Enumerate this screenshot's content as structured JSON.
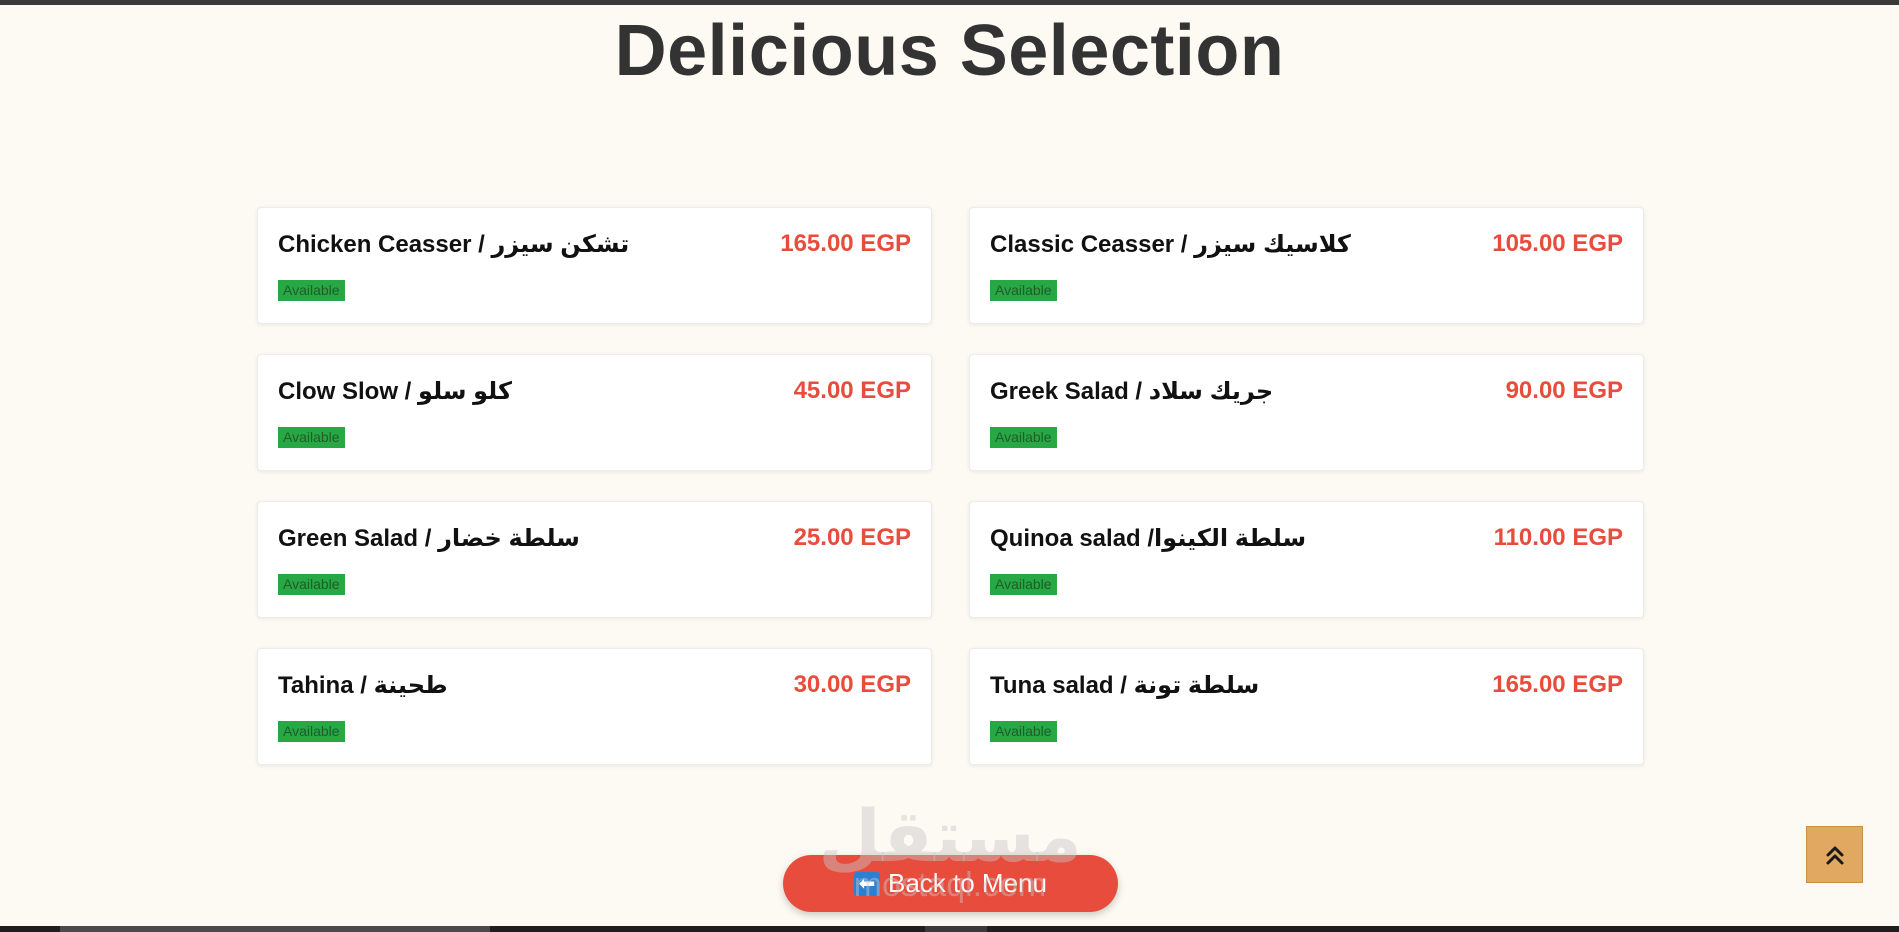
{
  "page": {
    "title": "Delicious Selection"
  },
  "items": [
    {
      "name": "Chicken Ceasser / تشكن سيزر",
      "price": "165.00 EGP",
      "status": "Available"
    },
    {
      "name": "Classic Ceasser / كلاسيك سيزر",
      "price": "105.00 EGP",
      "status": "Available"
    },
    {
      "name": "Clow Slow / كلو سلو",
      "price": "45.00 EGP",
      "status": "Available"
    },
    {
      "name": "Greek Salad / جريك سلاد",
      "price": "90.00 EGP",
      "status": "Available"
    },
    {
      "name": "Green Salad / سلطة خضار",
      "price": "25.00 EGP",
      "status": "Available"
    },
    {
      "name": "Quinoa salad /سلطة الكينوا",
      "price": "110.00 EGP",
      "status": "Available"
    },
    {
      "name": "Tahina / طحينة",
      "price": "30.00 EGP",
      "status": "Available"
    },
    {
      "name": "Tuna salad / سلطة تونة",
      "price": "165.00 EGP",
      "status": "Available"
    }
  ],
  "back_button": {
    "icon": "⬅",
    "label": "Back to Menu"
  },
  "watermark": {
    "arabic": "مستقل",
    "latin": "mostaql.com"
  },
  "scroll_top": {
    "icon": "double-chevron-up-icon"
  },
  "colors": {
    "price": "#e74c3c",
    "badge": "#28a745",
    "button": "#e74c3c",
    "scroll_top": "#e0a860",
    "background": "#fdf9f3"
  }
}
